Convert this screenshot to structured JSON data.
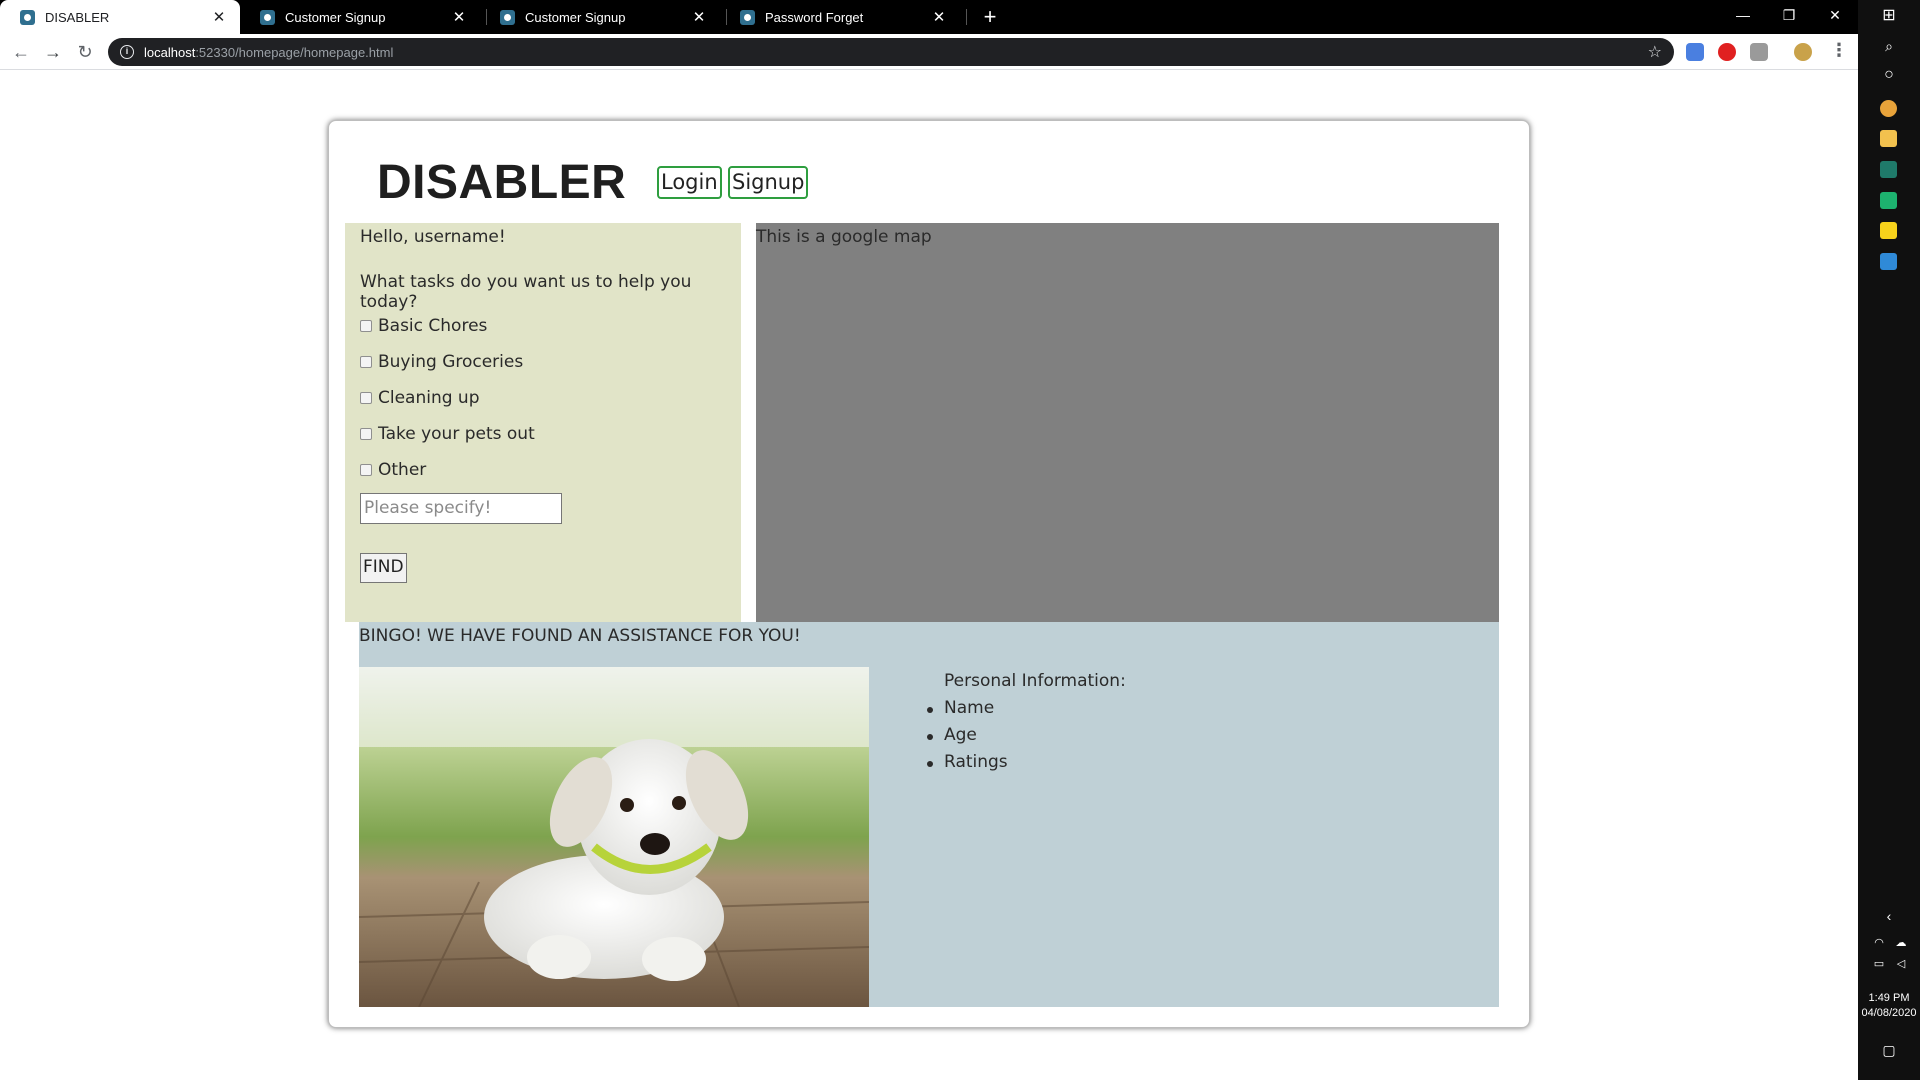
{
  "browser": {
    "tabs": [
      {
        "label": "DISABLER",
        "active": true
      },
      {
        "label": "Customer Signup",
        "active": false
      },
      {
        "label": "Customer Signup",
        "active": false
      },
      {
        "label": "Password Forget",
        "active": false
      }
    ],
    "url_host": "localhost",
    "url_path": ":52330/homepage/homepage.html"
  },
  "page": {
    "brand": "DISABLER",
    "nav": {
      "login": "Login",
      "signup": "Signup"
    },
    "left": {
      "greeting": "Hello, username!",
      "question": "What tasks do you want us to help you today?",
      "tasks": [
        "Basic Chores",
        "Buying Groceries",
        "Cleaning up",
        "Take your pets out",
        "Other"
      ],
      "specify_placeholder": "Please specify!",
      "find_label": "FIND"
    },
    "map_text": "This is a google map",
    "result": {
      "headline": "BINGO! WE HAVE FOUND AN ASSISTANCE FOR YOU!",
      "info_title": "Personal Information:",
      "info_items": [
        "Name",
        "Age",
        "Ratings"
      ]
    }
  },
  "taskbar": {
    "time": "1:49 PM",
    "date": "04/08/2020"
  },
  "colors": {
    "left_panel": "#e1e4c8",
    "map_panel": "#808080",
    "result_panel": "#bfd0d6",
    "nav_border": "#2e9e3f"
  }
}
